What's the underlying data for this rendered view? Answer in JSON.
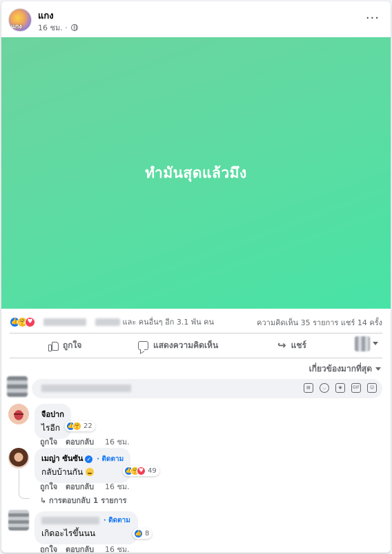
{
  "post": {
    "page_name": "แกง",
    "avatar_text": "แกง",
    "time": "16 ชม. ·",
    "text": "ทำมันสุดแล้วมึง",
    "reactions_text": "และ คนอื่นๆ อีก 3.1 พัน คน",
    "comments_shares": "ความคิดเห็น 35 รายการ  แชร์ 14 ครั้ง"
  },
  "actions": {
    "like": "ถูกใจ",
    "comment": "แสดงความคิดเห็น",
    "share": "แชร์"
  },
  "sort_label": "เกี่ยวข้องมากที่สุด",
  "composer": {
    "placeholder": "",
    "tools": [
      "sticker-icon",
      "emoji-icon",
      "camera-icon",
      "gif-icon",
      "sticker2-icon"
    ],
    "gif_label": "GIF"
  },
  "comments": [
    {
      "author": "จือปาก",
      "text": "ไรอีก",
      "reactions": "22",
      "like": "ถูกใจ",
      "reply": "ตอบกลับ",
      "time": "16 ชม."
    },
    {
      "author": "เมญ่า ซันซัน",
      "follow": "· ติดตาม",
      "text": "กลับบ้านกัน",
      "reactions": "49",
      "like": "ถูกใจ",
      "reply": "ตอบกลับ",
      "time": "16 ชม.",
      "replies": "↳ การตอบกลับ 1 รายการ"
    },
    {
      "author": "",
      "follow": "· ติดตาม",
      "text": "เกิดอะไรขึ้นนน",
      "reactions": "8",
      "like": "ถูกใจ",
      "reply": "ตอบกลับ",
      "time": "16 ชม."
    }
  ]
}
